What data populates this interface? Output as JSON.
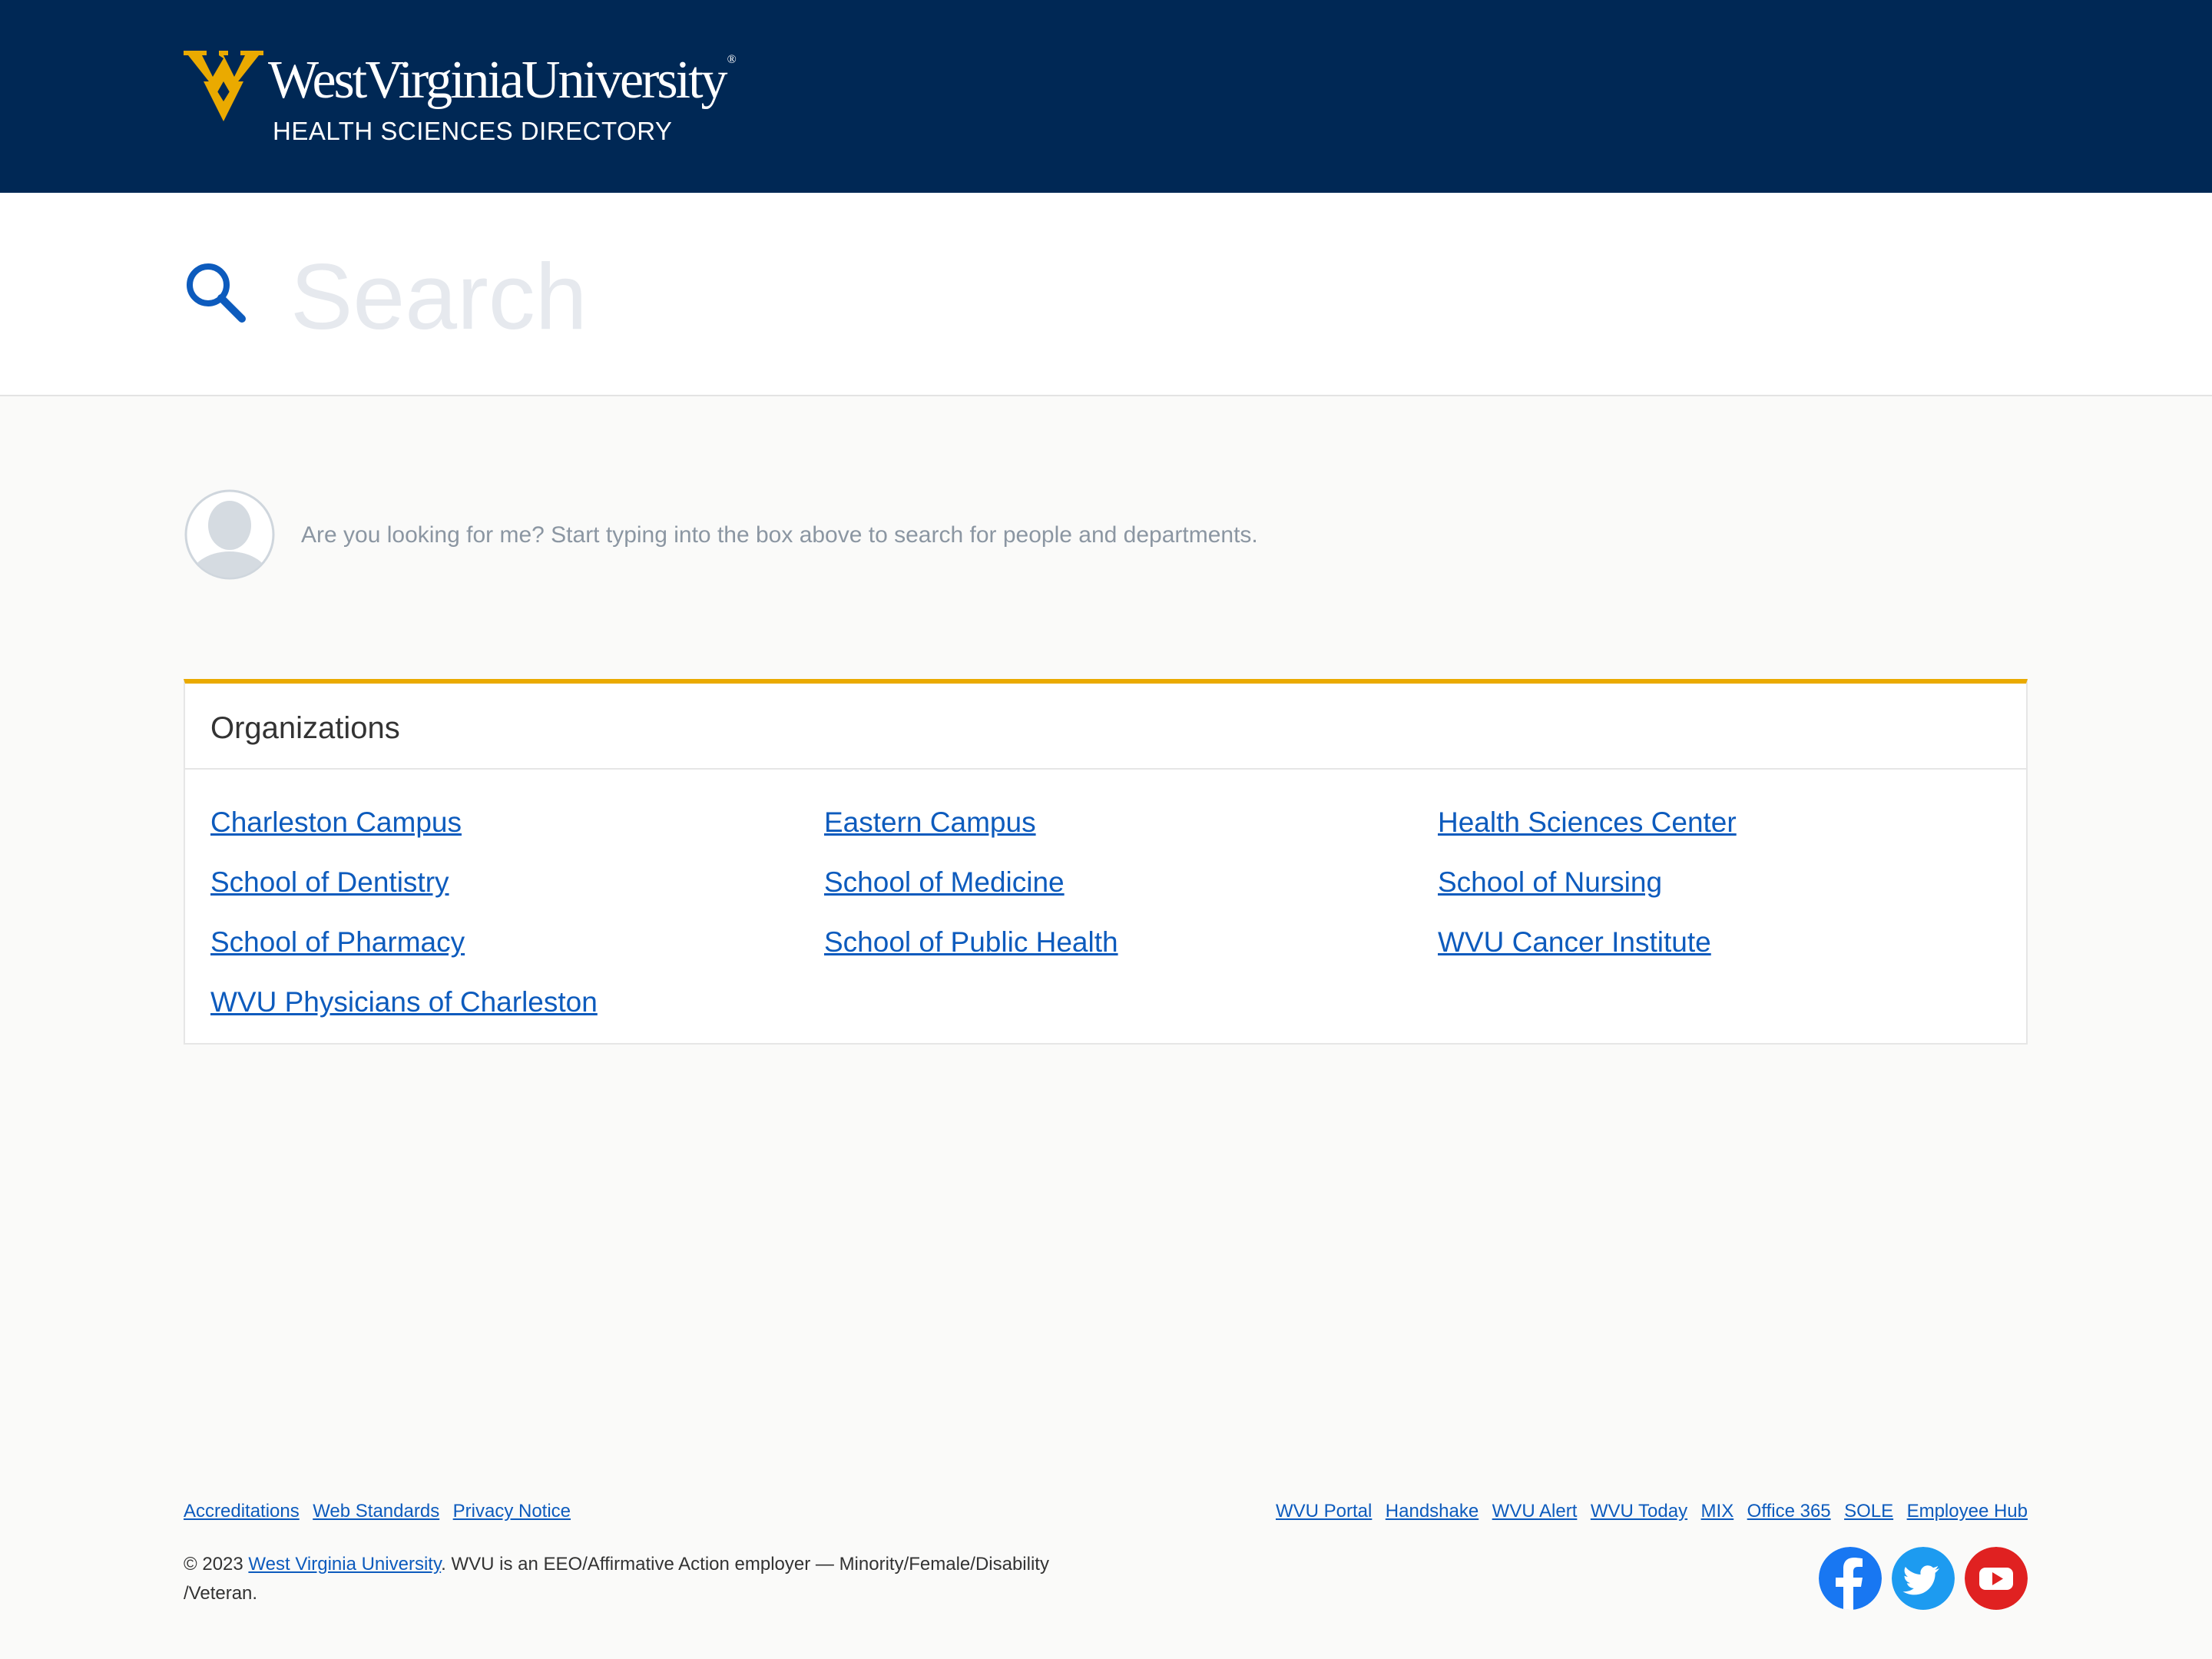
{
  "header": {
    "wordmark": "WestVirginiaUniversity",
    "subtitle": "HEALTH SCIENCES DIRECTORY",
    "brand_navy": "#002855",
    "brand_gold": "#eaaa00"
  },
  "search": {
    "placeholder": "Search",
    "value": "",
    "icon": "search-icon"
  },
  "prompt": {
    "avatar_icon": "user-avatar-icon",
    "text": "Are you looking for me? Start typing into the box above to search for people and departments."
  },
  "organizations": {
    "title": "Organizations",
    "links": [
      "Charleston Campus",
      "Eastern Campus",
      "Health Sciences Center",
      "School of Dentistry",
      "School of Medicine",
      "School of Nursing",
      "School of Pharmacy",
      "School of Public Health",
      "WVU Cancer Institute",
      "WVU Physicians of Charleston"
    ]
  },
  "footer": {
    "left_links": [
      "Accreditations",
      "Web Standards",
      "Privacy Notice"
    ],
    "right_links": [
      "WVU Portal",
      "Handshake",
      "WVU Alert",
      "WVU Today",
      "MIX",
      "Office 365",
      "SOLE",
      "Employee Hub"
    ],
    "copyright_prefix": "© 2023",
    "copyright_link": "West Virginia University",
    "copyright_suffix": ". WVU is an EEO/Affirmative Action employer — Minority/Female/Disability /Veteran.",
    "social": [
      {
        "name": "facebook-icon",
        "color": "#1877f2"
      },
      {
        "name": "twitter-icon",
        "color": "#1d9bf0"
      },
      {
        "name": "youtube-icon",
        "color": "#e02121"
      }
    ],
    "link_color": "#0d5bbd"
  }
}
